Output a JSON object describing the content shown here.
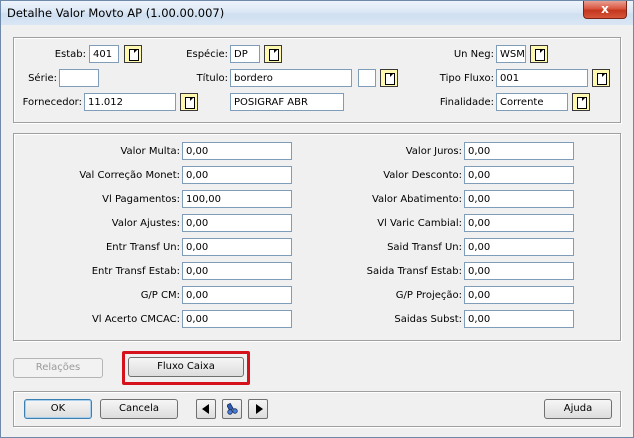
{
  "window": {
    "title": "Detalhe Valor Movto AP (1.00.00.007)",
    "close_glyph": "x"
  },
  "header": {
    "estab": {
      "label": "Estab:",
      "value": "401"
    },
    "especie": {
      "label": "Espécie:",
      "value": "DP"
    },
    "un_neg": {
      "label": "Un Neg:",
      "value": "WSM"
    },
    "serie": {
      "label": "Série:",
      "value": ""
    },
    "titulo": {
      "label": "Título:",
      "value": "bordero",
      "extra": ""
    },
    "tipo_fluxo": {
      "label": "Tipo Fluxo:",
      "value": "001"
    },
    "fornecedor": {
      "label": "Fornecedor:",
      "value": "11.012",
      "name": "POSIGRAF ABR"
    },
    "finalidade": {
      "label": "Finalidade:",
      "value": "Corrente"
    }
  },
  "values": {
    "left": [
      {
        "label": "Valor Multa:",
        "value": "0,00"
      },
      {
        "label": "Val Correção Monet:",
        "value": "0,00"
      },
      {
        "label": "Vl Pagamentos:",
        "value": "100,00"
      },
      {
        "label": "Valor Ajustes:",
        "value": "0,00"
      },
      {
        "label": "Entr Transf Un:",
        "value": "0,00"
      },
      {
        "label": "Entr Transf Estab:",
        "value": "0,00"
      },
      {
        "label": "G/P CM:",
        "value": "0,00"
      },
      {
        "label": "Vl Acerto CMCAC:",
        "value": "0,00"
      }
    ],
    "right": [
      {
        "label": "Valor Juros:",
        "value": "0,00"
      },
      {
        "label": "Valor Desconto:",
        "value": "0,00"
      },
      {
        "label": "Valor Abatimento:",
        "value": "0,00"
      },
      {
        "label": "Vl Varic Cambial:",
        "value": "0,00"
      },
      {
        "label": "Said Transf Un:",
        "value": "0,00"
      },
      {
        "label": "Saida Transf Estab:",
        "value": "0,00"
      },
      {
        "label": "G/P Projeção:",
        "value": "0,00"
      },
      {
        "label": "Saidas Subst:",
        "value": "0,00"
      }
    ]
  },
  "actions": {
    "relacoes": "Relações",
    "fluxo_caixa": "Fluxo Caixa"
  },
  "footer": {
    "ok": "OK",
    "cancel": "Cancela",
    "help": "Ajuda"
  },
  "colors": {
    "highlight": "#d6111b",
    "zoom_bg": "#fff9b0"
  },
  "icons": {
    "prev": "triangle-left-icon",
    "search": "binoculars-icon",
    "next": "triangle-right-icon",
    "zoom": "zoom-icon"
  }
}
